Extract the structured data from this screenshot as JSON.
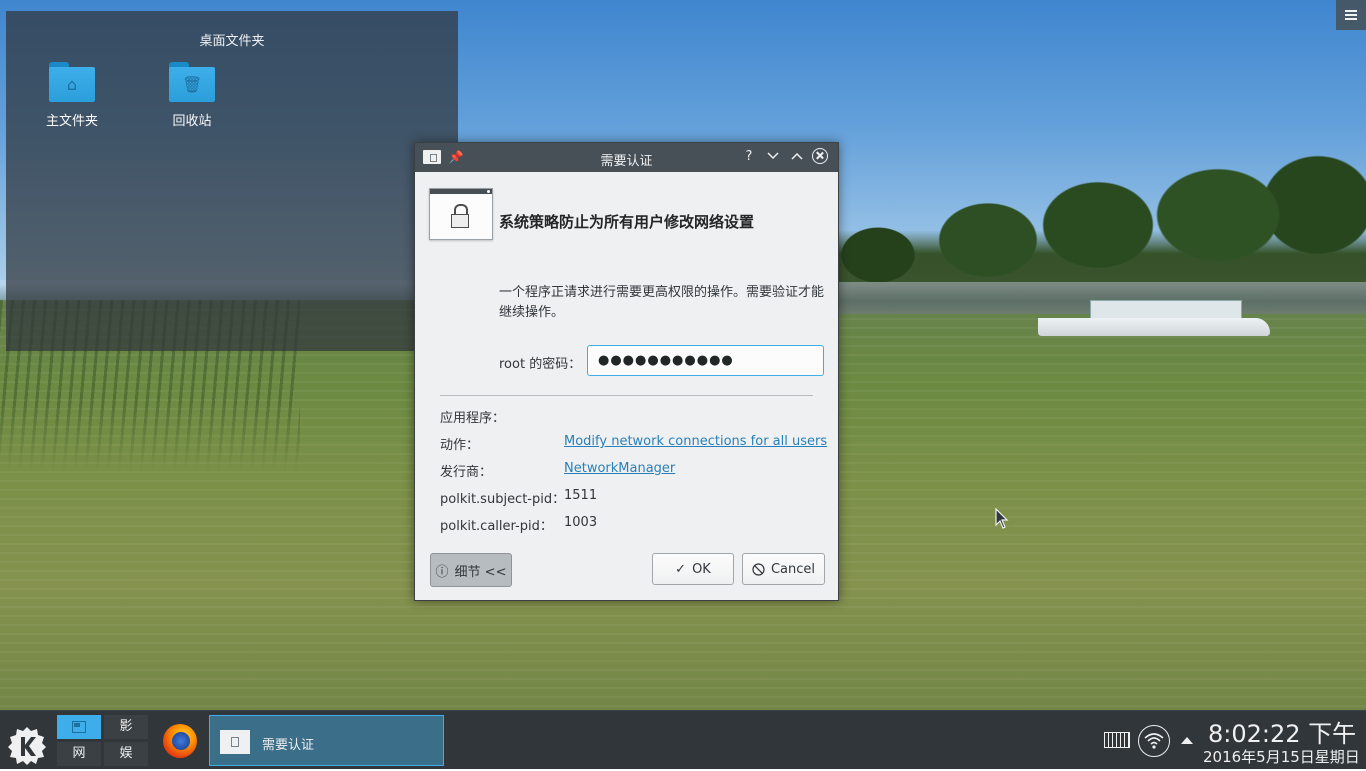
{
  "desktop": {
    "folderview_title": "桌面文件夹",
    "icons": [
      {
        "label": "主文件夹",
        "glyph": "⌂"
      },
      {
        "label": "回收站",
        "glyph": "🗑"
      }
    ]
  },
  "dialog": {
    "title": "需要认证",
    "titlebar_buttons": {
      "help": "?",
      "minimize": "⌄",
      "maximize": "⌃"
    },
    "headline": "系统策略防止为所有用户修改网络设置",
    "description": "一个程序正请求进行需要更高权限的操作。需要验证才能继续操作。",
    "password_label": "root 的密码：",
    "password_value": "●●●●●●●●●●●",
    "details": [
      {
        "key": "应用程序：",
        "value": "",
        "link": false
      },
      {
        "key": "动作：",
        "value": "Modify network connections for all users",
        "link": true
      },
      {
        "key": "发行商：",
        "value": "NetworkManager",
        "link": true
      },
      {
        "key": "polkit.subject-pid：",
        "value": "1511",
        "link": false
      },
      {
        "key": "polkit.caller-pid：",
        "value": "1003",
        "link": false
      }
    ],
    "buttons": {
      "details": "细节 <<",
      "ok": "OK",
      "cancel": "Cancel"
    },
    "button_icons": {
      "details": "ⓘ",
      "ok": "✓",
      "cancel": "⃠"
    }
  },
  "taskbar": {
    "pager": [
      "",
      "影",
      "网",
      "娱"
    ],
    "active_task": "需要认证",
    "clock_time": "8:02:22 下午",
    "clock_date": "2016年5月15日星期日"
  },
  "colors": {
    "accent": "#3daee9",
    "panel": "#31363b",
    "titlebar": "#475057",
    "link": "#2980b9"
  }
}
